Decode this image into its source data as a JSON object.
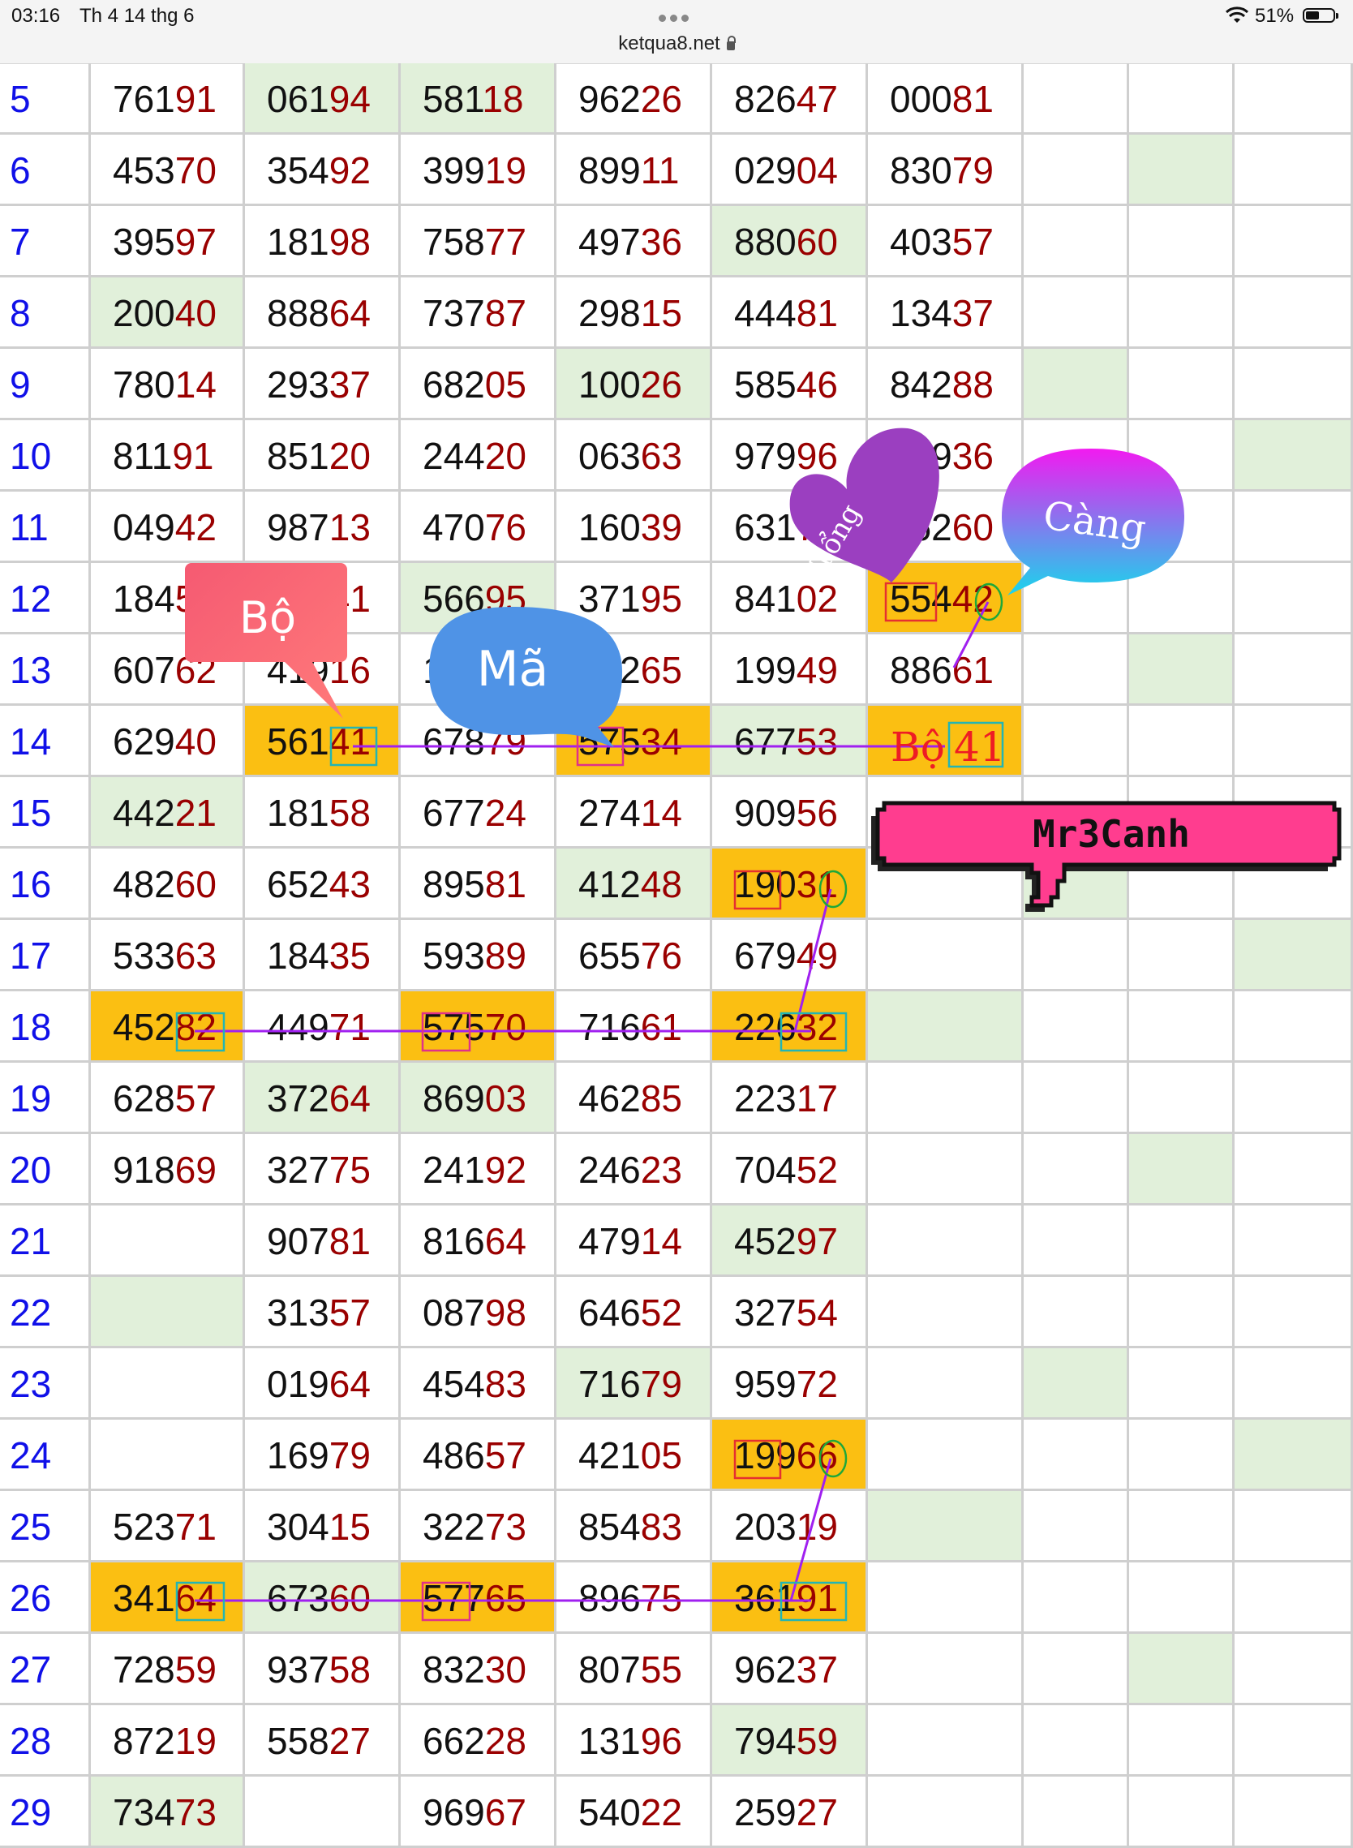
{
  "status_bar": {
    "time": "03:16",
    "date": "Th 4 14 thg 6",
    "url": "ketqua8.net",
    "battery": "51%",
    "battery_level": 0.51
  },
  "table": {
    "rows": [
      {
        "index": "5",
        "cells": [
          "76191",
          "06194",
          "58118",
          "96226",
          "82647",
          "00081",
          "",
          "",
          ""
        ],
        "bg": [
          "",
          "g",
          "g",
          "",
          "",
          "",
          "",
          "",
          ""
        ]
      },
      {
        "index": "6",
        "cells": [
          "45370",
          "35492",
          "39919",
          "89911",
          "02904",
          "83079",
          "",
          "",
          ""
        ],
        "bg": [
          "",
          "",
          "",
          "",
          "",
          "",
          "",
          "g",
          ""
        ]
      },
      {
        "index": "7",
        "cells": [
          "39597",
          "18198",
          "75877",
          "49736",
          "88060",
          "40357",
          "",
          "",
          ""
        ],
        "bg": [
          "",
          "",
          "",
          "",
          "g",
          "",
          "",
          "",
          ""
        ]
      },
      {
        "index": "8",
        "cells": [
          "20040",
          "88864",
          "73787",
          "29815",
          "44481",
          "13437",
          "",
          "",
          ""
        ],
        "bg": [
          "g",
          "",
          "",
          "",
          "",
          "",
          "",
          "",
          ""
        ]
      },
      {
        "index": "9",
        "cells": [
          "78014",
          "29337",
          "68205",
          "10026",
          "58546",
          "84288",
          "",
          "",
          ""
        ],
        "bg": [
          "",
          "",
          "",
          "g",
          "",
          "",
          "g",
          "",
          ""
        ]
      },
      {
        "index": "10",
        "cells": [
          "81191",
          "85120",
          "24420",
          "06363",
          "97996",
          "81936",
          "",
          "",
          ""
        ],
        "bg": [
          "",
          "",
          "",
          "",
          "",
          "",
          "",
          "",
          "g"
        ]
      },
      {
        "index": "11",
        "cells": [
          "04942",
          "98713",
          "47076",
          "16039",
          "63170",
          "26260",
          "",
          "",
          ""
        ],
        "bg": [
          "",
          "",
          "",
          "",
          "",
          "",
          "",
          "",
          ""
        ]
      },
      {
        "index": "12",
        "cells": [
          "18454",
          "69541",
          "56695",
          "37195",
          "84102",
          "55442",
          "",
          "",
          ""
        ],
        "bg": [
          "",
          "",
          "g",
          "",
          "",
          "o",
          "",
          "",
          ""
        ]
      },
      {
        "index": "13",
        "cells": [
          "60762",
          "41916",
          "19081",
          "44265",
          "19949",
          "88661",
          "",
          "",
          ""
        ],
        "bg": [
          "",
          "",
          "",
          "",
          "",
          "",
          "",
          "g",
          ""
        ]
      },
      {
        "index": "14",
        "cells": [
          "62940",
          "56141",
          "67879",
          "57534",
          "67753",
          "",
          "",
          "",
          ""
        ],
        "bg": [
          "",
          "o",
          "",
          "o",
          "g",
          "o",
          "",
          "",
          ""
        ]
      },
      {
        "index": "15",
        "cells": [
          "44221",
          "18158",
          "67724",
          "27414",
          "90956",
          "",
          "",
          "",
          ""
        ],
        "bg": [
          "g",
          "",
          "",
          "",
          "",
          "",
          "",
          "",
          ""
        ]
      },
      {
        "index": "16",
        "cells": [
          "48260",
          "65243",
          "89581",
          "41248",
          "19031",
          "",
          "",
          "",
          ""
        ],
        "bg": [
          "",
          "",
          "",
          "g",
          "o",
          "",
          "g",
          "",
          ""
        ]
      },
      {
        "index": "17",
        "cells": [
          "53363",
          "18435",
          "59389",
          "65576",
          "67949",
          "",
          "",
          "",
          ""
        ],
        "bg": [
          "",
          "",
          "",
          "",
          "",
          "",
          "",
          "",
          "g"
        ]
      },
      {
        "index": "18",
        "cells": [
          "45282",
          "44971",
          "57570",
          "71661",
          "22632",
          "",
          "",
          "",
          ""
        ],
        "bg": [
          "o",
          "",
          "o",
          "",
          "o",
          "g",
          "",
          "",
          ""
        ]
      },
      {
        "index": "19",
        "cells": [
          "62857",
          "37264",
          "86903",
          "46285",
          "22317",
          "",
          "",
          "",
          ""
        ],
        "bg": [
          "",
          "g",
          "g",
          "",
          "",
          "",
          "",
          "",
          ""
        ]
      },
      {
        "index": "20",
        "cells": [
          "91869",
          "32775",
          "24192",
          "24623",
          "70452",
          "",
          "",
          "",
          ""
        ],
        "bg": [
          "",
          "",
          "",
          "",
          "",
          "",
          "",
          "g",
          ""
        ]
      },
      {
        "index": "21",
        "cells": [
          "",
          "90781",
          "81664",
          "47914",
          "45297",
          "",
          "",
          "",
          ""
        ],
        "bg": [
          "",
          "",
          "",
          "",
          "g",
          "",
          "",
          "",
          ""
        ]
      },
      {
        "index": "22",
        "cells": [
          "",
          "31357",
          "08798",
          "64652",
          "32754",
          "",
          "",
          "",
          ""
        ],
        "bg": [
          "g",
          "",
          "",
          "",
          "",
          "",
          "",
          "",
          ""
        ]
      },
      {
        "index": "23",
        "cells": [
          "",
          "01964",
          "45483",
          "71679",
          "95972",
          "",
          "",
          "",
          ""
        ],
        "bg": [
          "",
          "",
          "",
          "g",
          "",
          "",
          "g",
          "",
          ""
        ]
      },
      {
        "index": "24",
        "cells": [
          "",
          "16979",
          "48657",
          "42105",
          "19966",
          "",
          "",
          "",
          ""
        ],
        "bg": [
          "",
          "",
          "",
          "",
          "o",
          "",
          "",
          "",
          "g"
        ]
      },
      {
        "index": "25",
        "cells": [
          "52371",
          "30415",
          "32273",
          "85483",
          "20319",
          "",
          "",
          "",
          ""
        ],
        "bg": [
          "",
          "",
          "",
          "",
          "",
          "g",
          "",
          "",
          ""
        ]
      },
      {
        "index": "26",
        "cells": [
          "34164",
          "67360",
          "57765",
          "89675",
          "36191",
          "",
          "",
          "",
          ""
        ],
        "bg": [
          "o",
          "g",
          "o",
          "",
          "o",
          "",
          "",
          "",
          ""
        ]
      },
      {
        "index": "27",
        "cells": [
          "72859",
          "93758",
          "83230",
          "80755",
          "96237",
          "",
          "",
          "",
          ""
        ],
        "bg": [
          "",
          "",
          "",
          "",
          "",
          "",
          "",
          "g",
          ""
        ]
      },
      {
        "index": "28",
        "cells": [
          "87219",
          "55827",
          "66228",
          "13196",
          "79459",
          "",
          "",
          "",
          ""
        ],
        "bg": [
          "",
          "",
          "",
          "",
          "g",
          "",
          "",
          "",
          ""
        ]
      },
      {
        "index": "29",
        "cells": [
          "73473",
          "",
          "96967",
          "54022",
          "25927",
          "",
          "",
          "",
          ""
        ],
        "bg": [
          "g",
          "",
          "",
          "",
          "",
          "",
          "",
          "",
          ""
        ]
      }
    ]
  },
  "annotations": {
    "bo_bubble": "Bộ",
    "ma_bubble": "Mã",
    "tong_heart": "Tổng",
    "cang_bubble": "Càng",
    "bo41_label": "Bộ",
    "bo41_value": "41",
    "signature": "Mr3Canh",
    "colors": {
      "bo_bubble": "#f25c7a",
      "ma_bubble": "#4f93e6",
      "tong_heart": "#9b3fc0",
      "cang_bubble_from": "#f21af0",
      "cang_bubble_to": "#18d6ec",
      "signature_bg": "#ff3d8f",
      "connector": "#a020f0",
      "highlight_orange": "#fbbf12",
      "highlight_green": "#e1f0da"
    }
  }
}
